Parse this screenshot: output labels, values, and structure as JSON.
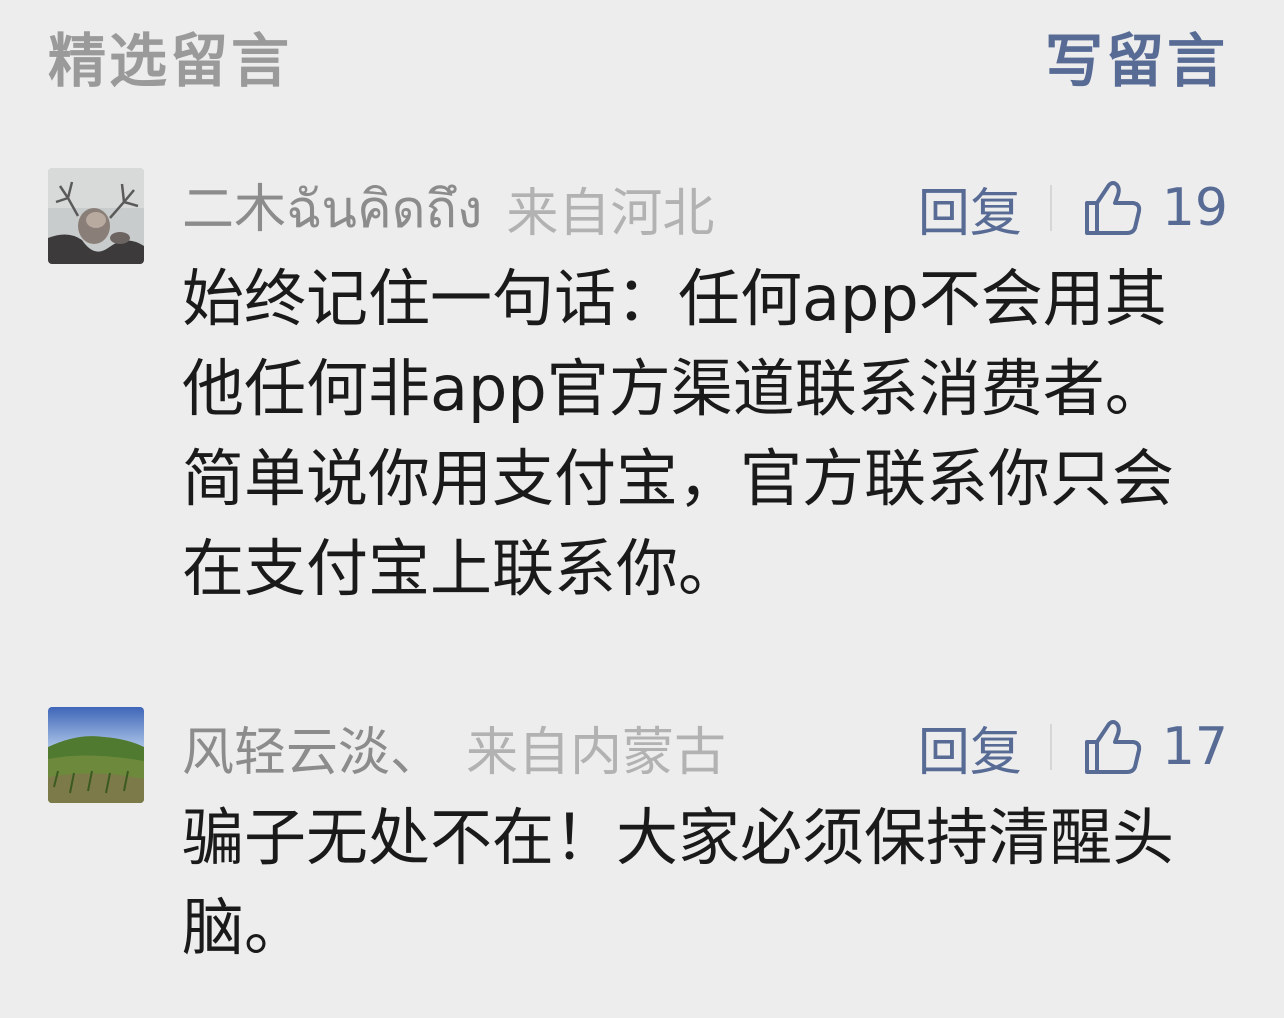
{
  "header": {
    "title": "精选留言",
    "write_label": "写留言"
  },
  "comments": [
    {
      "nickname": "二木ฉันคิดถึง",
      "location": "来自河北",
      "reply_label": "回复",
      "likes": "19",
      "content": "始终记住一句话：任何app不会用其他任何非app官方渠道联系消费者。简单说你用支付宝，官方联系你只会在支付宝上联系你。"
    },
    {
      "nickname": "风轻云淡、",
      "location": "来自内蒙古",
      "reply_label": "回复",
      "likes": "17",
      "content": "骗子无处不在！大家必须保持清醒头脑。"
    }
  ],
  "colors": {
    "background": "#ededed",
    "link": "#576b95",
    "muted": "#9a9a9a",
    "text": "#1a1a1a"
  },
  "icons": [
    "thumbs-up-icon"
  ]
}
